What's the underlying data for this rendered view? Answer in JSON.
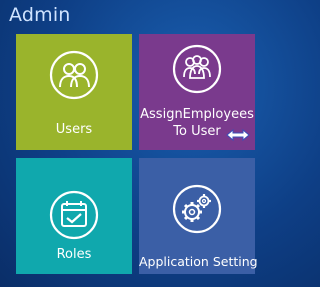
{
  "header": {
    "title": "Admin"
  },
  "tiles": [
    {
      "label": "Users",
      "color": "#9ab42c",
      "icon": "users-icon"
    },
    {
      "label_line1": "AssignEmployees",
      "label_line2": "To User",
      "color": "#7a3a8d",
      "icon": "group-icon"
    },
    {
      "label": "Roles",
      "color": "#10a8ad",
      "icon": "calendar-check-icon"
    },
    {
      "label": "Application Setting",
      "color": "#3b5fa6",
      "icon": "gears-icon"
    }
  ],
  "cursor": {
    "icon": "resize-horizontal-cursor-icon"
  }
}
